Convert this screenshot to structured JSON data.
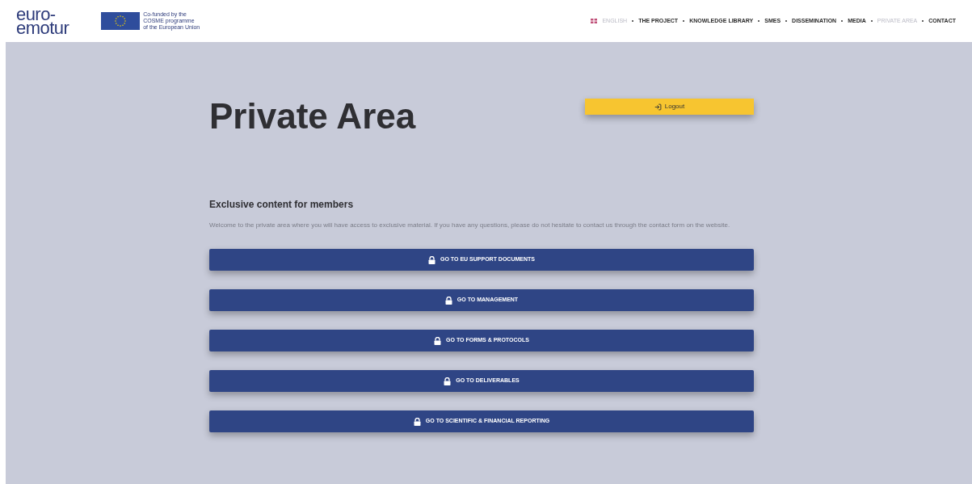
{
  "header": {
    "logo_lines": [
      "euro-",
      "emotur"
    ],
    "eu_badge": [
      "Co-funded by the",
      "COSME programme",
      "of the European Union"
    ]
  },
  "nav": [
    {
      "label": "ENGLISH",
      "kind": "language",
      "selected": true
    },
    {
      "label": "THE PROJECT",
      "kind": "link",
      "selected": false
    },
    {
      "label": "KNOWLEDGE LIBRARY",
      "kind": "link",
      "selected": false
    },
    {
      "label": "SMES",
      "kind": "link",
      "selected": false
    },
    {
      "label": "DISSEMINATION",
      "kind": "link",
      "selected": false
    },
    {
      "label": "MEDIA",
      "kind": "link",
      "selected": false
    },
    {
      "label": "PRIVATE AREA",
      "kind": "link",
      "selected": true
    },
    {
      "label": "CONTACT",
      "kind": "link",
      "selected": false
    }
  ],
  "page": {
    "title": "Private Area",
    "logout": "Logout",
    "heading": "Exclusive content for members",
    "intro": "Welcome to the private area where you will have access to exclusive material. If you have any questions, please do not hesitate to contact us through the contact form on the website.",
    "buttons": [
      "GO TO EU SUPPORT DOCUMENTS",
      "GO TO MANAGEMENT",
      "GO TO FORMS & PROTOCOLS",
      "GO TO DELIVERABLES",
      "GO TO SCIENTIFIC & FINANCIAL REPORTING"
    ]
  }
}
